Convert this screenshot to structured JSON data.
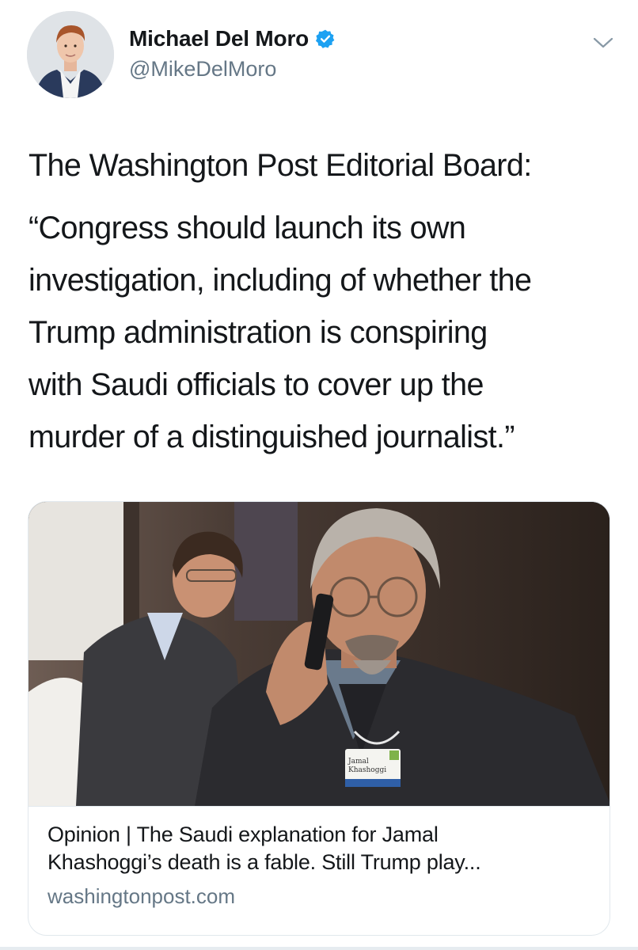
{
  "author": {
    "display_name": "Michael Del Moro",
    "handle": "@MikeDelMoro",
    "verified": true,
    "avatar_icon": "profile-photo",
    "verified_icon": "verified-badge-icon"
  },
  "menu": {
    "icon": "chevron-down-icon"
  },
  "tweet": {
    "lead": "The Washington Post Editorial Board:",
    "quote_lines": [
      "“Congress should launch its own",
      "investigation, including of whether the",
      "Trump administration is conspiring",
      "with Saudi officials to cover up the",
      "murder of a distinguished journalist.”"
    ]
  },
  "card": {
    "title_line1": "Opinion | The Saudi explanation for Jamal",
    "title_line2": "Khashoggi’s death is a fable. Still Trump play...",
    "domain": "washingtonpost.com",
    "image": "photo of man on phone wearing a name badge"
  },
  "colors": {
    "text": "#14171a",
    "secondary": "#657786",
    "verified_blue": "#1da1f2",
    "border": "#e1e8ed"
  }
}
